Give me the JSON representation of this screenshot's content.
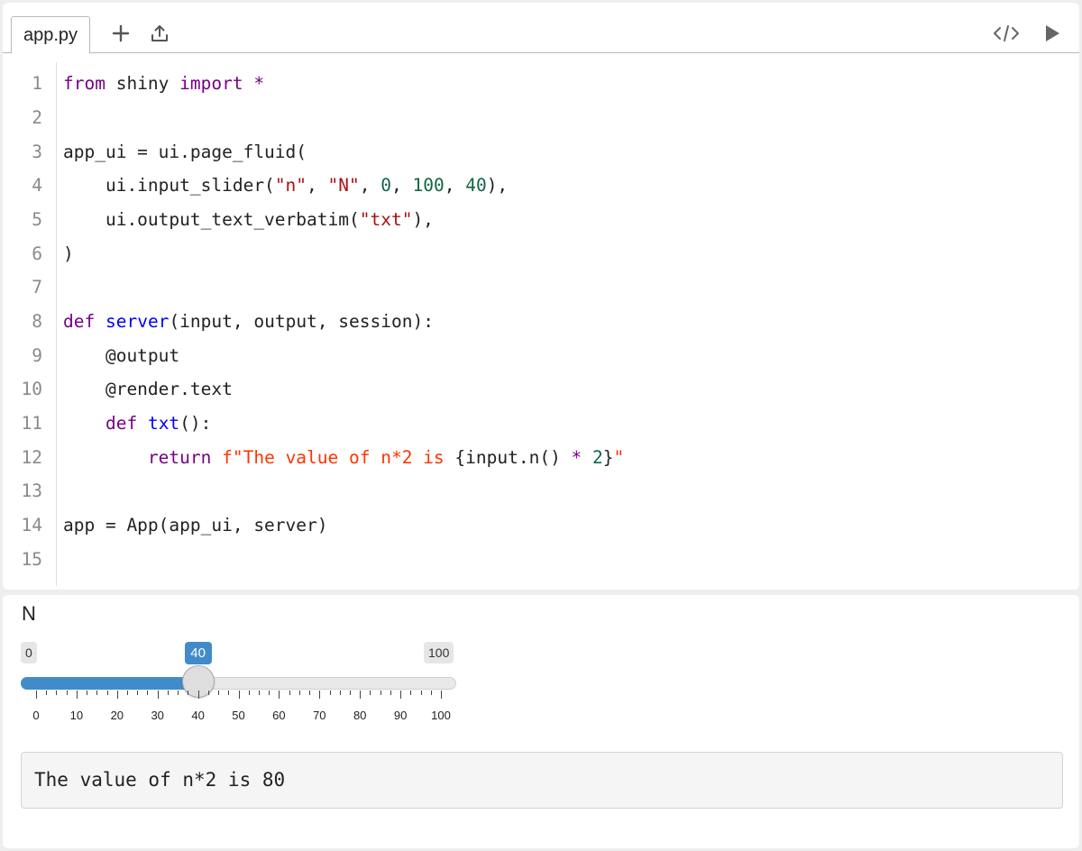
{
  "tabs": [
    {
      "label": "app.py",
      "active": true
    }
  ],
  "toolbar": {
    "add_icon": "plus-icon",
    "upload_icon": "upload-icon",
    "code_icon": "code-icon",
    "run_icon": "play-icon"
  },
  "code": {
    "line_numbers": [
      "1",
      "2",
      "3",
      "4",
      "5",
      "6",
      "7",
      "8",
      "9",
      "10",
      "11",
      "12",
      "13",
      "14",
      "15"
    ],
    "l1": {
      "kw": "from",
      "mid": " shiny ",
      "kw2": "import",
      "sp": " ",
      "star": "*"
    },
    "l3": {
      "text": "app_ui = ui.page_fluid("
    },
    "l4": {
      "a": "    ui.input_slider(",
      "s1": "\"n\"",
      "c1": ", ",
      "s2": "\"N\"",
      "c2": ", ",
      "n1": "0",
      "c3": ", ",
      "n2": "100",
      "c4": ", ",
      "n3": "40",
      "end": "),"
    },
    "l5": {
      "a": "    ui.output_text_verbatim(",
      "s1": "\"txt\"",
      "end": "),"
    },
    "l6": {
      "text": ")"
    },
    "l8": {
      "kw": "def",
      "sp": " ",
      "fn": "server",
      "rest": "(input, output, session):"
    },
    "l9": {
      "text": "    @output"
    },
    "l10": {
      "text": "    @render.text"
    },
    "l11": {
      "ind": "    ",
      "kw": "def",
      "sp": " ",
      "fn": "txt",
      "rest": "():"
    },
    "l12": {
      "ind": "        ",
      "kw": "return",
      "sp": " ",
      "f1": "f\"The value of n*2 is ",
      "mid": "{input.n() ",
      "op": "*",
      "sp2": " ",
      "num": "2",
      "close": "}",
      "f2": "\""
    },
    "l14": {
      "text": "app = App(app_ui, server)"
    }
  },
  "app": {
    "slider": {
      "label": "N",
      "min_label": "0",
      "max_label": "100",
      "value_label": "40",
      "min": 0,
      "max": 100,
      "value": 40,
      "tick_labels": [
        "0",
        "10",
        "20",
        "30",
        "40",
        "50",
        "60",
        "70",
        "80",
        "90",
        "100"
      ]
    },
    "output_text": "The value of n*2 is 80"
  },
  "colors": {
    "accent": "#428bca",
    "keyword": "#770088",
    "function": "#0000ff",
    "string": "#aa1111",
    "fstring": "#ff3300",
    "number": "#116644"
  }
}
